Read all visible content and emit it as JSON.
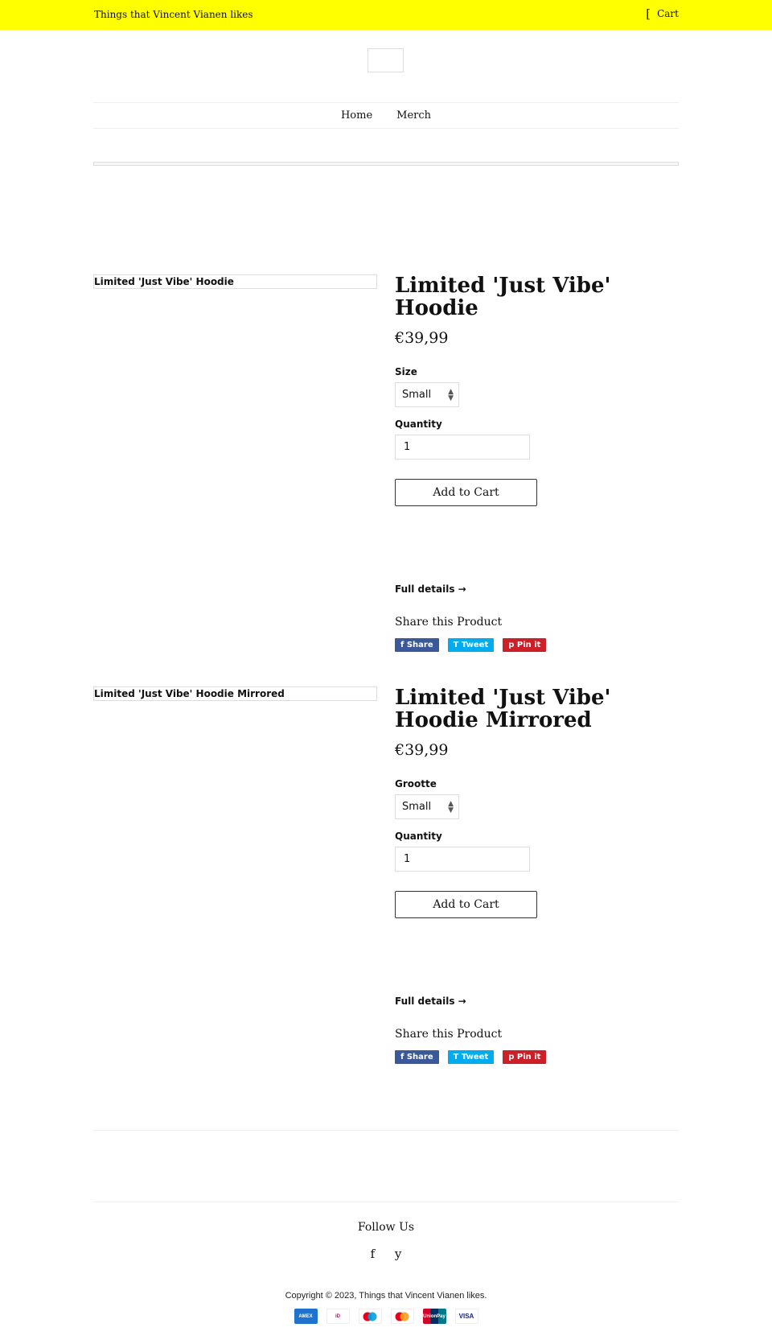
{
  "header": {
    "store_name": "Things that Vincent Vianen likes",
    "cart_icon": "cart-icon",
    "cart_label": "Cart"
  },
  "nav": {
    "items": [
      {
        "label": "Home"
      },
      {
        "label": "Merch"
      }
    ]
  },
  "products": [
    {
      "image_alt": "Limited 'Just Vibe' Hoodie",
      "title": "Limited 'Just Vibe' Hoodie",
      "price": "€39,99",
      "option_label": "Size",
      "option_value": "Small",
      "quantity_label": "Quantity",
      "quantity_value": "1",
      "add_to_cart": "Add to Cart",
      "full_details": "Full details →",
      "share_heading": "Share this Product",
      "share": {
        "facebook": "f  Share",
        "twitter": "T  Tweet",
        "pinterest": "p  Pin it"
      }
    },
    {
      "image_alt": "Limited 'Just Vibe' Hoodie Mirrored",
      "title": "Limited 'Just Vibe' Hoodie Mirrored",
      "price": "€39,99",
      "option_label": "Grootte",
      "option_value": "Small",
      "quantity_label": "Quantity",
      "quantity_value": "1",
      "add_to_cart": "Add to Cart",
      "full_details": "Full details →",
      "share_heading": "Share this Product",
      "share": {
        "facebook": "f  Share",
        "twitter": "T  Tweet",
        "pinterest": "p  Pin it"
      }
    }
  ],
  "footer": {
    "follow_heading": "Follow Us",
    "social": [
      {
        "glyph": "f",
        "icon": "facebook-icon"
      },
      {
        "glyph": "y",
        "icon": "youtube-icon"
      }
    ],
    "copyright": "Copyright © 2023, Things that Vincent Vianen likes.",
    "payments": [
      {
        "name": "American Express",
        "label": "AMEX"
      },
      {
        "name": "iDEAL",
        "label": "iD"
      },
      {
        "name": "Maestro",
        "label": ""
      },
      {
        "name": "Mastercard",
        "label": ""
      },
      {
        "name": "UnionPay",
        "label": "UnionPay"
      },
      {
        "name": "Visa",
        "label": "VISA"
      }
    ]
  },
  "colors": {
    "topbar": "#ffff00",
    "facebook": "#3b5998",
    "twitter": "#00aced",
    "pinterest": "#cb2027"
  }
}
